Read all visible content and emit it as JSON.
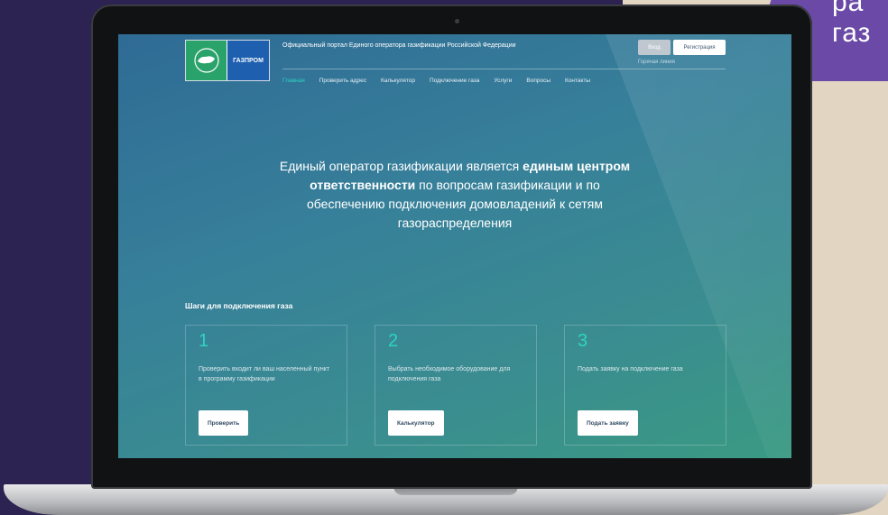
{
  "ribbon": {
    "text_line1": "ра",
    "text_line2": "газ"
  },
  "header": {
    "logo_right_text": "ГАЗПРОМ",
    "portal_title": "Официальный портал Единого оператора газификации Российской Федерации",
    "login_label": "Вход",
    "register_label": "Регистрация",
    "hotline": "Горячая линия"
  },
  "nav": {
    "items": [
      "Главная",
      "Проверить адрес",
      "Калькулятор",
      "Подключение газа",
      "Услуги",
      "Вопросы",
      "Контакты"
    ],
    "active_index": 0
  },
  "hero": {
    "part1": "Единый оператор газификации является ",
    "bold1": "единым центром ответственности",
    "part2": " по вопросам газификации и по обеспечению подключения домовладений к сетям газораспределения"
  },
  "steps": {
    "title": "Шаги для подключения газа",
    "cards": [
      {
        "num": "1",
        "text": "Проверить входит ли ваш населенный пункт в программу газификации",
        "button": "Проверить"
      },
      {
        "num": "2",
        "text": "Выбрать необходимое оборудование для подключения газа",
        "button": "Калькулятор"
      },
      {
        "num": "3",
        "text": "Подать заявку на подключение газа",
        "button": "Подать заявку"
      }
    ]
  },
  "colors": {
    "accent": "#2fd3c2",
    "background": "#2c2352",
    "beige": "#e2d5c1",
    "ribbon": "#6a4aa6"
  }
}
